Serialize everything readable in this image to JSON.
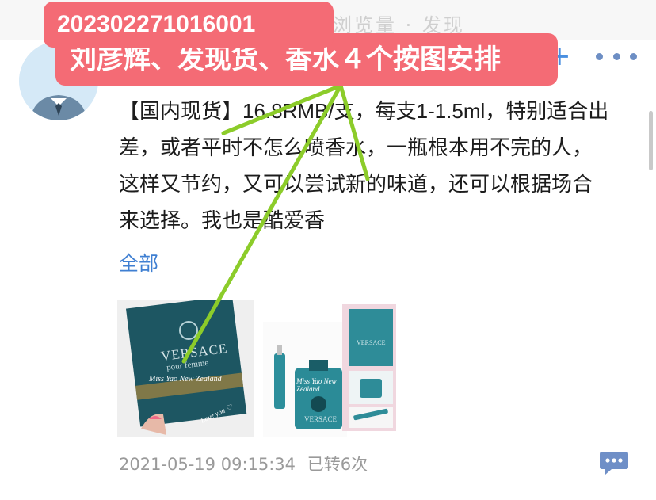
{
  "app": {
    "faded_header_text": "浏览量 · 发现"
  },
  "post": {
    "text": "【国内现货】16.8RMB/支，每支1-1.5ml，特别适合出差，或者平时不怎么喷香水，一瓶根本用不完的人，这样又节约，又可以尝试新的味道，还可以根据场合来选择。我也是酷爱香",
    "show_all_label": "全部",
    "timestamp": "2021-05-19 09:15:34",
    "repost_count": "已转6次",
    "images": [
      {
        "brand_line1": "VERSACE",
        "brand_line2": "pour femme",
        "watermark": "Miss Yao New Zealand",
        "signature": "Love you ♡"
      },
      {
        "watermark": "Miss Yao New Zealand",
        "bottle_label": "VERSACE"
      },
      {
        "label": "VERSACE"
      }
    ]
  },
  "controls": {
    "plus_icon": "plus-icon",
    "more_icon": "more-horizontal-icon",
    "comment_icon": "comment-bubble-icon"
  },
  "overlay": {
    "order_id": "202302271016001",
    "note": "刘彦辉、发现货、香水４个按图安排",
    "color": "#f46b75",
    "arrow_color": "#8ccc2a"
  }
}
